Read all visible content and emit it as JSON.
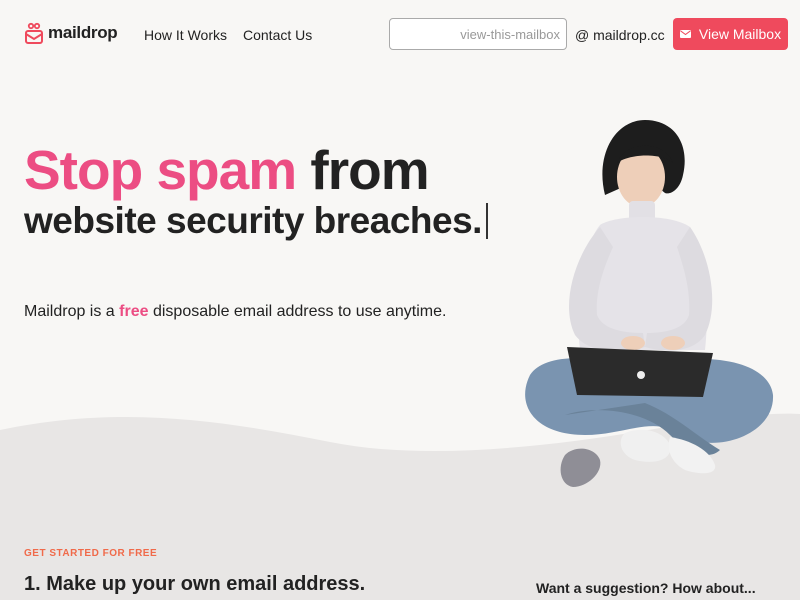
{
  "header": {
    "brand": "maildrop",
    "nav": [
      "How It Works",
      "Contact Us"
    ],
    "mailbox_placeholder": "view-this-mailbox",
    "domain": "@ maildrop.cc",
    "view_button": "View Mailbox"
  },
  "hero": {
    "headline_highlight": "Stop spam",
    "headline_rest": " from",
    "subheadline": "website security breaches.",
    "desc_before": "Maildrop is a ",
    "desc_highlight": "free",
    "desc_after": " disposable email address to use anytime."
  },
  "section": {
    "kicker": "GET STARTED FOR FREE",
    "step_title": "1. Make up your own email address.",
    "suggestion": "Want a suggestion? How about..."
  },
  "colors": {
    "accent_pink": "#ec4d83",
    "button_red": "#ef4a5d",
    "kicker_orange": "#f06a4a",
    "background": "#f8f7f5",
    "wave_gray": "#e8e6e5"
  },
  "icons": [
    "maildrop-logo-icon",
    "envelope-icon"
  ]
}
